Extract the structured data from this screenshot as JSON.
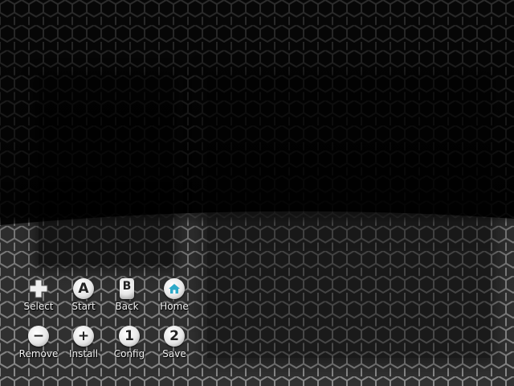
{
  "theme": {
    "background": "#000000",
    "hex_top": "#3a3a3a",
    "hex_bottom": "#8a8a8a",
    "home_accent": "#2ea9c8"
  },
  "buttons": [
    {
      "id": "select",
      "label": "Select",
      "icon": "dpad-plus-icon"
    },
    {
      "id": "start",
      "label": "Start",
      "icon": "a-button-icon",
      "glyph": "A"
    },
    {
      "id": "back",
      "label": "Back",
      "icon": "b-button-icon",
      "glyph": "B"
    },
    {
      "id": "home",
      "label": "Home",
      "icon": "home-button-icon"
    },
    {
      "id": "remove",
      "label": "Remove",
      "icon": "minus-button-icon",
      "glyph": "−"
    },
    {
      "id": "install",
      "label": "Install",
      "icon": "plus-button-icon",
      "glyph": "+"
    },
    {
      "id": "config",
      "label": "Config",
      "icon": "one-button-icon",
      "glyph": "1"
    },
    {
      "id": "save",
      "label": "Save",
      "icon": "two-button-icon",
      "glyph": "2"
    }
  ]
}
